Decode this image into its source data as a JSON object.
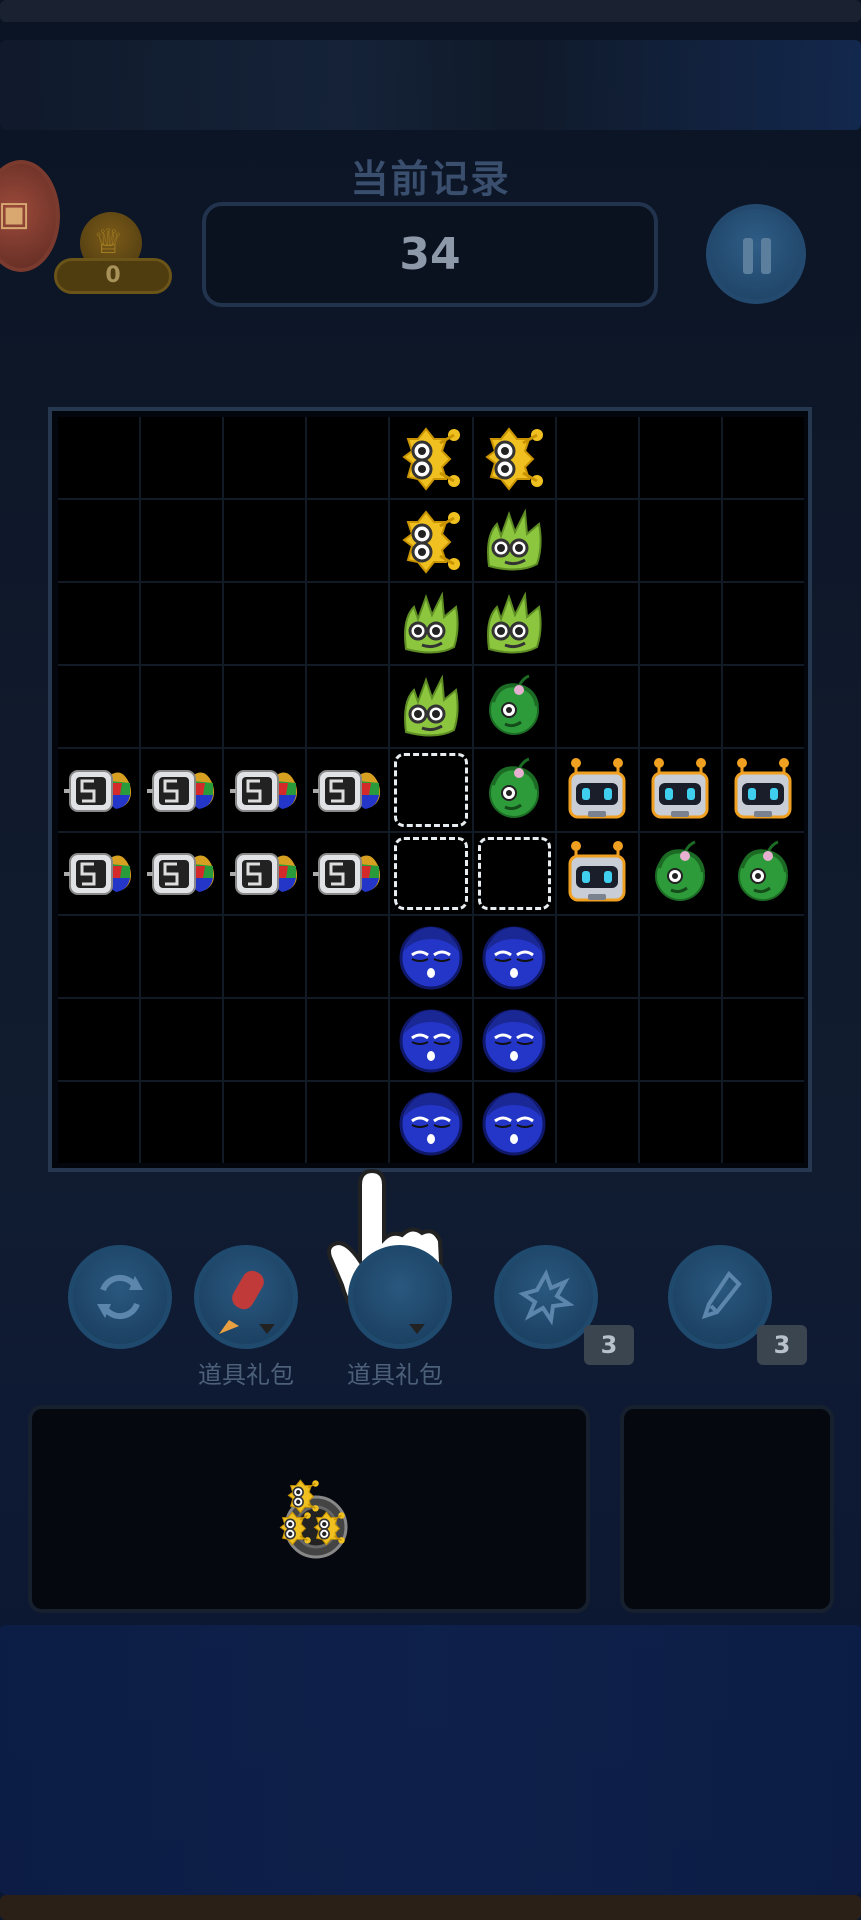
{
  "header": {
    "record_label": "当前记录",
    "score": "34",
    "crown_count": "0"
  },
  "colors": {
    "accent_blue": "#234a6e",
    "board_border": "#25384f",
    "gold": "#f0c020",
    "leaf_green": "#8cc63f",
    "vine_green": "#2e9b3a",
    "face_blue": "#2436c8",
    "robot_orange": "#f0a020"
  },
  "board": {
    "rows": [
      [
        "",
        "",
        "",
        "",
        "sun",
        "sun",
        "",
        "",
        ""
      ],
      [
        "",
        "",
        "",
        "",
        "sun",
        "leaf",
        "",
        "",
        ""
      ],
      [
        "",
        "",
        "",
        "",
        "leaf",
        "leaf",
        "",
        "",
        ""
      ],
      [
        "",
        "",
        "",
        "",
        "leaf",
        "vine",
        "",
        "",
        ""
      ],
      [
        "robo2",
        "robo2",
        "robo2",
        "robo2",
        "slot",
        "vine",
        "robot",
        "robot",
        "robot"
      ],
      [
        "robo2",
        "robo2",
        "robo2",
        "robo2",
        "slot",
        "slot",
        "robot",
        "vine",
        "vine"
      ],
      [
        "",
        "",
        "",
        "",
        "blue",
        "blue",
        "",
        "",
        ""
      ],
      [
        "",
        "",
        "",
        "",
        "blue",
        "blue",
        "",
        "",
        ""
      ],
      [
        "",
        "",
        "",
        "",
        "blue",
        "blue",
        "",
        "",
        ""
      ]
    ]
  },
  "tools": [
    {
      "icon": "refresh-icon",
      "label": ""
    },
    {
      "icon": "rocket-icon",
      "label": "道具礼包"
    },
    {
      "icon": "hammer-icon",
      "label": "道具礼包"
    },
    {
      "icon": "burst-icon",
      "label": "",
      "count": "3"
    },
    {
      "icon": "brush-icon",
      "label": "",
      "count": "3"
    }
  ],
  "tray": {
    "piece": "sun-cluster-piece"
  }
}
